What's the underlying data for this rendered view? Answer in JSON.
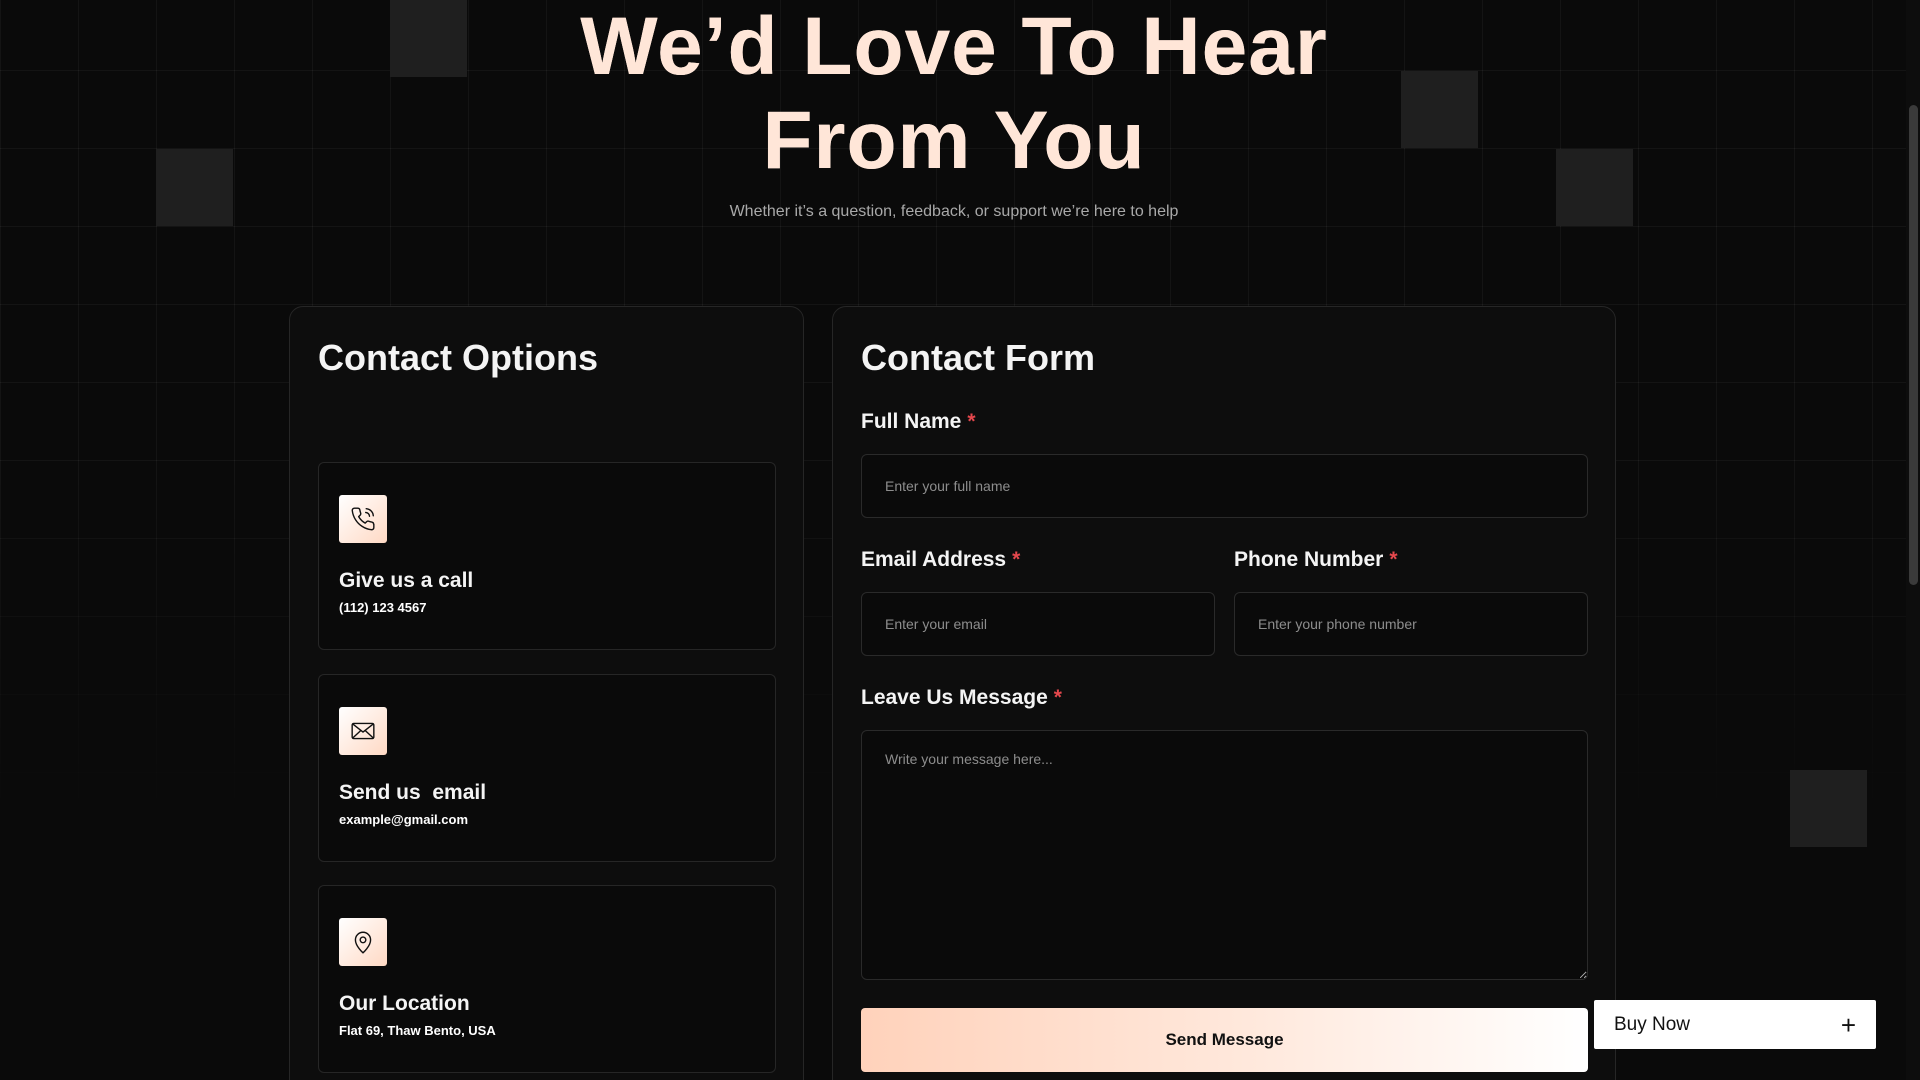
{
  "hero": {
    "title_line1": "We’d Love To Hear",
    "title_line2": "From You",
    "subtitle": "Whether it’s a question, feedback, or support we’re here to help"
  },
  "contact_options": {
    "title": "Contact Options",
    "items": [
      {
        "icon": "phone-icon",
        "title": "Give us a call",
        "value": "(112) 123 4567"
      },
      {
        "icon": "mail-icon",
        "title": "Send us  email",
        "value": "example@gmail.com"
      },
      {
        "icon": "location-pin-icon",
        "title": "Our Location",
        "value": "Flat 69, Thaw Bento, USA"
      }
    ]
  },
  "contact_form": {
    "title": "Contact Form",
    "required_marker": "*",
    "full_name": {
      "label": "Full Name",
      "placeholder": "Enter your full name",
      "value": ""
    },
    "email": {
      "label": "Email Address",
      "placeholder": "Enter your email",
      "value": ""
    },
    "phone": {
      "label": "Phone Number",
      "placeholder": "Enter your phone number",
      "value": ""
    },
    "message": {
      "label": "Leave Us Message",
      "placeholder": "Write your message here...",
      "value": ""
    },
    "submit_label": "Send Message"
  },
  "buy_now": {
    "label": "Buy Now",
    "icon": "plus-icon",
    "symbol": "+"
  },
  "colors": {
    "background": "#0a0a0a",
    "accent_peach": "#ffd9c4",
    "required_red": "#e5484d",
    "card_border": "#262626"
  }
}
